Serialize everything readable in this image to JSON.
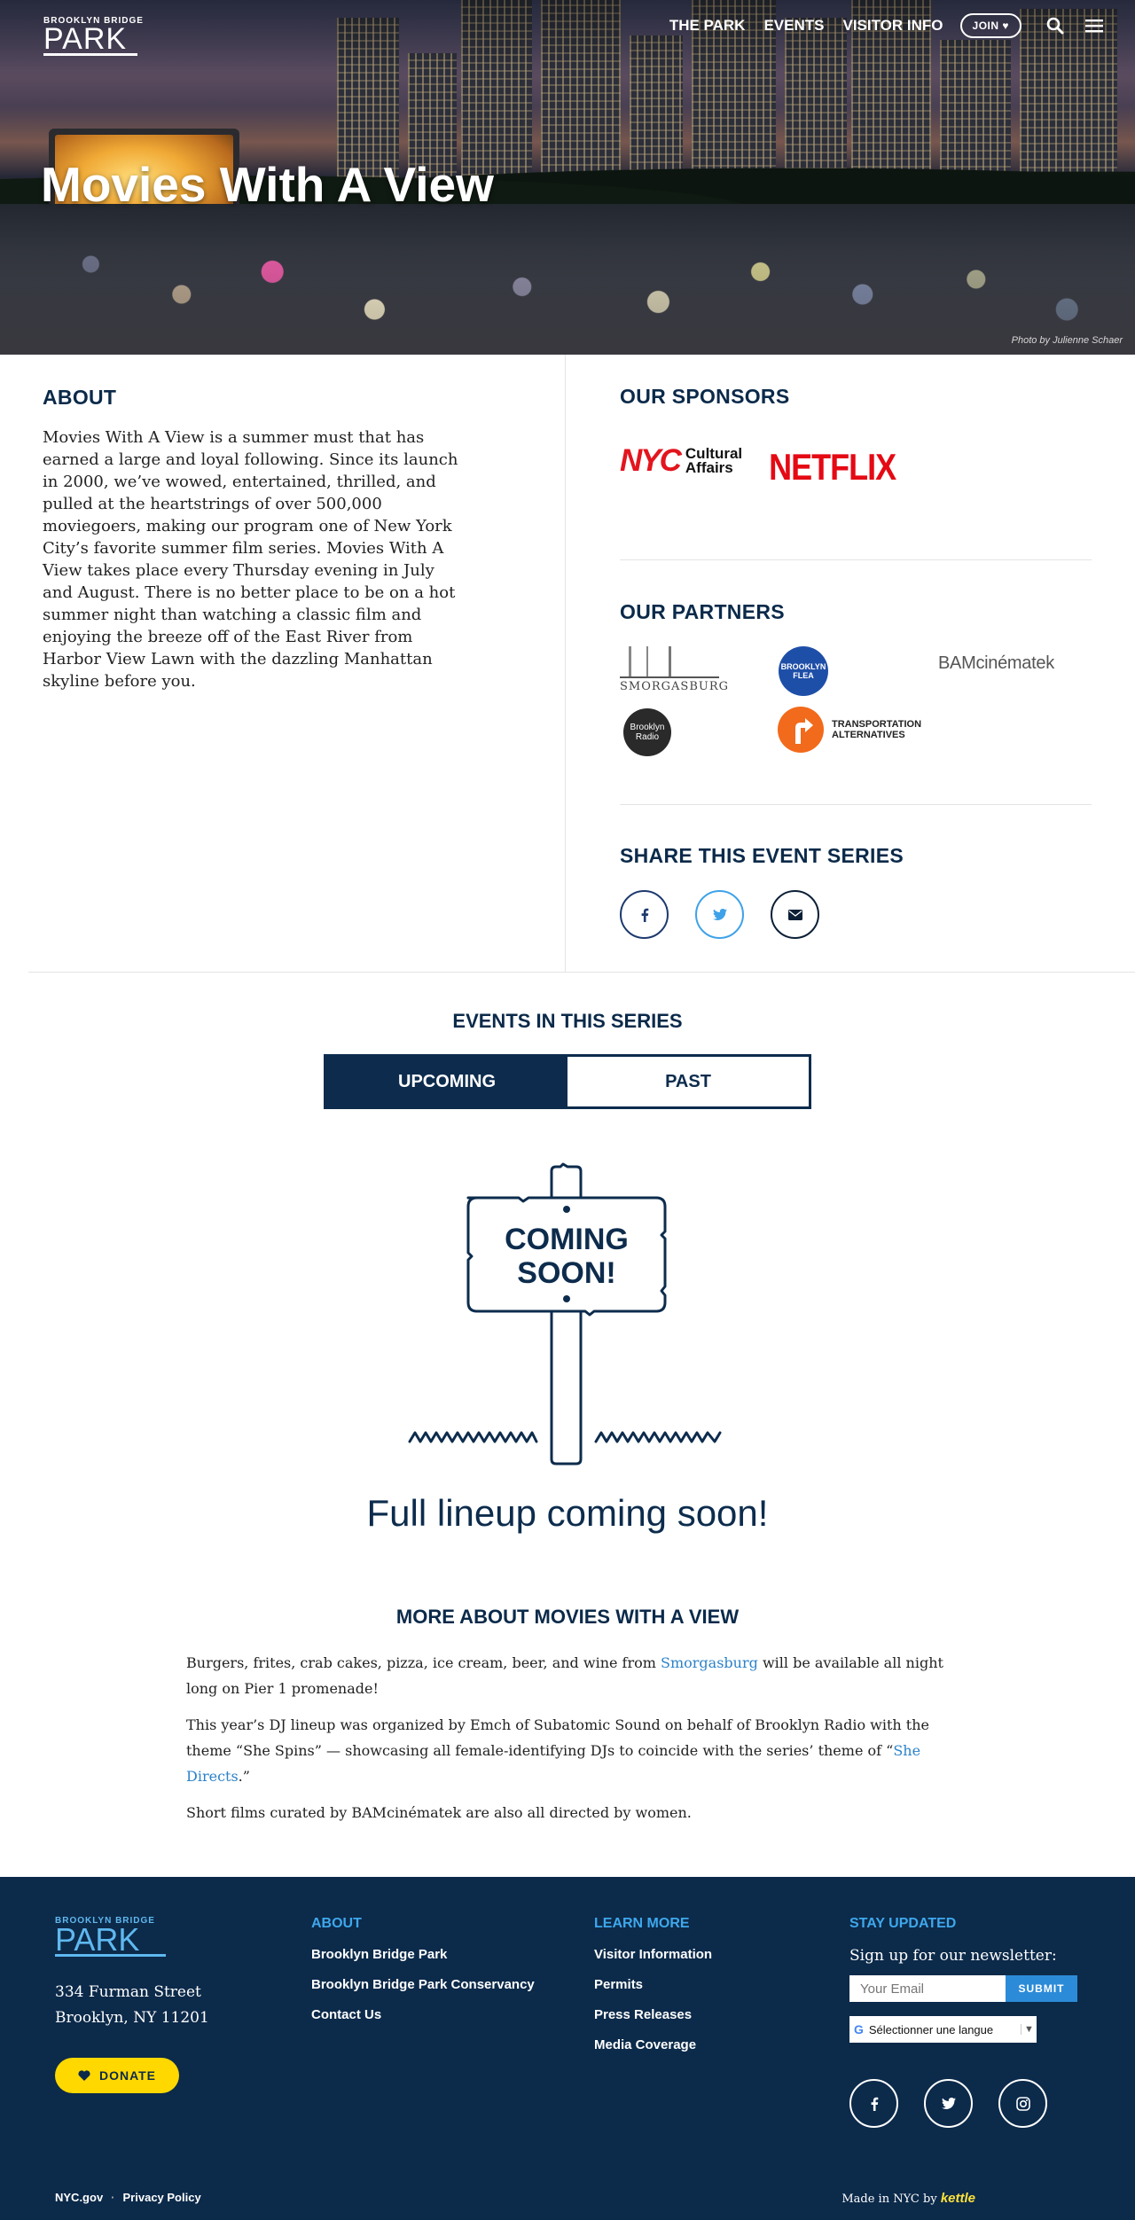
{
  "header": {
    "logo_small": "BROOKLYN BRIDGE",
    "logo_big": "PARK",
    "nav": [
      "THE PARK",
      "EVENTS",
      "VISITOR INFO"
    ],
    "join_label": "JOIN ♥",
    "hero_title": "Movies With A View",
    "photo_credit": "Photo by Julienne Schaer"
  },
  "about": {
    "heading": "ABOUT",
    "text": "Movies With A View is a summer must that has earned a large and loyal following. Since its launch in 2000, we’ve wowed, entertained, thrilled, and pulled at the heartstrings of over 500,000 moviegoers, making our program one of New York City’s favorite summer film series. Movies With A View takes place every Thursday evening in July and August. There is no better place to be on a hot summer night than watching a classic film and enjoying the breeze off of the East River from Harbor View Lawn with the dazzling Manhattan skyline before you."
  },
  "sponsors": {
    "heading": "OUR SPONSORS",
    "nyc_mark": "NYC",
    "nyc_line1": "Cultural",
    "nyc_line2": "Affairs",
    "netflix": "NETFLIX"
  },
  "partners": {
    "heading": "OUR PARTNERS",
    "smorgasburg": "SMORGASBURG",
    "flea": "BROOKLYN FLEA",
    "bam": "BAMcinématek",
    "radio_line1": "Brooklyn",
    "radio_line2": "Radio",
    "ta_line1": "TRANSPORTATION",
    "ta_line2": "ALTERNATIVES"
  },
  "share": {
    "heading": "SHARE THIS EVENT SERIES",
    "icons": [
      "facebook-icon",
      "twitter-icon",
      "email-icon"
    ]
  },
  "events": {
    "heading": "EVENTS IN THIS SERIES",
    "tab_upcoming": "UPCOMING",
    "tab_past": "PAST",
    "sign_line1": "COMING",
    "sign_line2": "SOON!",
    "lineup": "Full lineup coming soon!"
  },
  "more": {
    "heading": "MORE ABOUT MOVIES WITH A VIEW",
    "p1_before": "Burgers, frites, crab cakes, pizza, ice cream, beer, and wine from ",
    "p1_link": "Smorgasburg",
    "p1_after": " will be available all night long on Pier 1 promenade!",
    "p2_before": "This year’s DJ lineup was organized by Emch of Subatomic Sound on behalf of Brooklyn Radio with the theme “She Spins” — showcasing all female-identifying DJs to coincide with the series’ theme of “",
    "p2_link": "She Directs",
    "p2_after": ".”",
    "p3": "Short films curated by BAMcinématek are also all directed by women."
  },
  "footer": {
    "logo_small": "BROOKLYN BRIDGE",
    "logo_big": "PARK",
    "address_line1": "334 Furman Street",
    "address_line2": "Brooklyn, NY 11201",
    "donate_label": "DONATE",
    "about_heading": "ABOUT",
    "about_links": [
      "Brooklyn Bridge Park",
      "Brooklyn Bridge Park Conservancy",
      "Contact Us"
    ],
    "learn_heading": "LEARN MORE",
    "learn_links": [
      "Visitor Information",
      "Permits",
      "Press Releases",
      "Media Coverage"
    ],
    "stay_heading": "STAY UPDATED",
    "stay_lead": "Sign up for our newsletter:",
    "email_placeholder": "Your Email",
    "submit_label": "SUBMIT",
    "language_label": "Sélectionner une langue",
    "bottom_links": [
      "NYC.gov",
      "Privacy Policy"
    ],
    "made_in": "Made in NYC by ",
    "kettle": "kettle"
  },
  "colors": {
    "navy": "#0c2a4a",
    "accent_blue": "#3ea8ec",
    "donate_yellow": "#ffd800",
    "link_blue": "#2c82c9"
  }
}
